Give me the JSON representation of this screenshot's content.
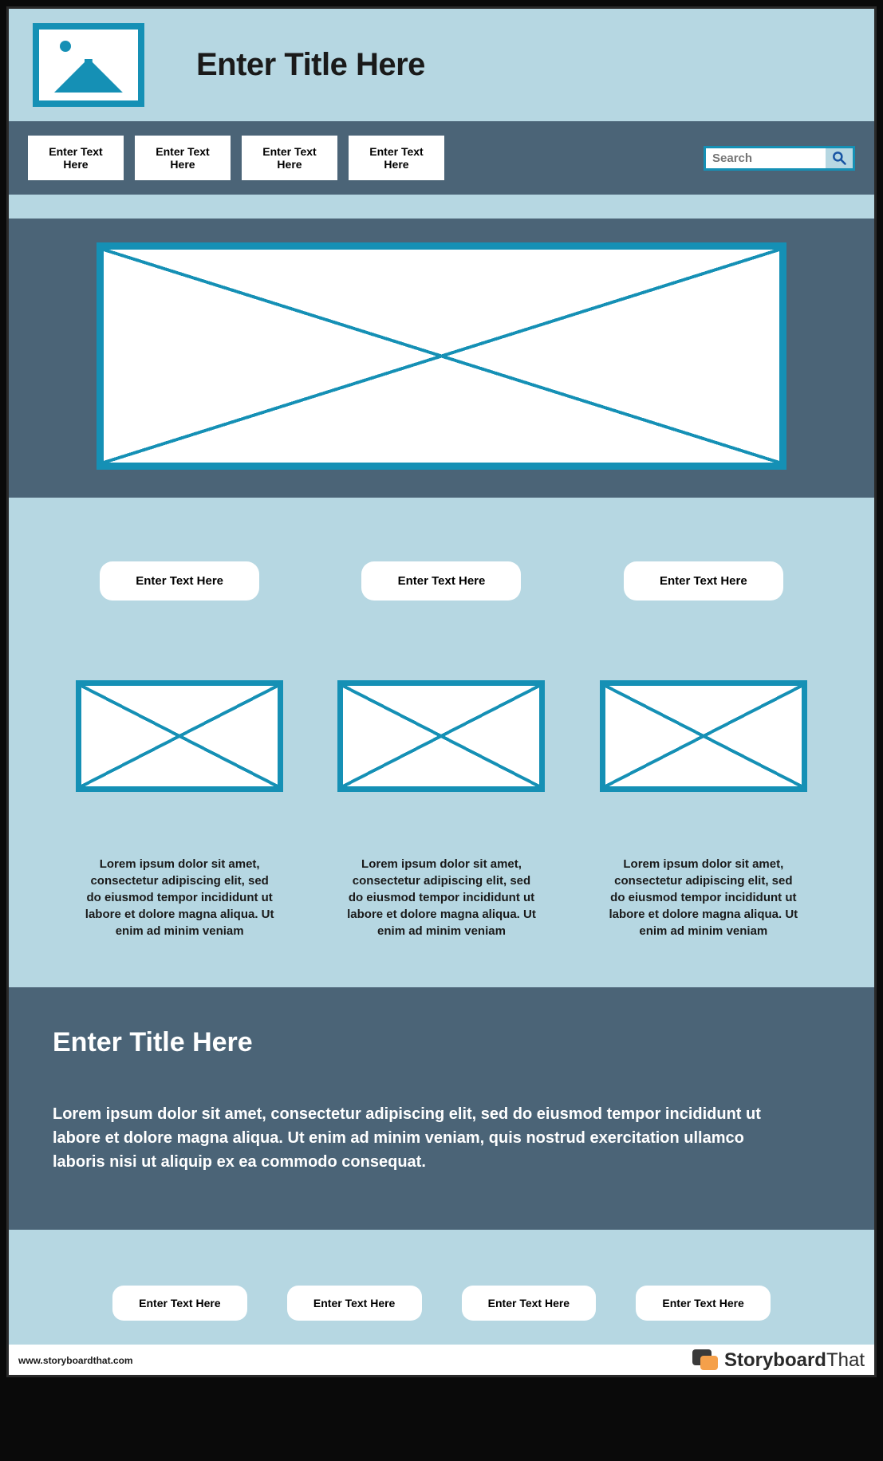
{
  "header": {
    "title": "Enter Title Here"
  },
  "nav": {
    "items": [
      {
        "label": "Enter Text Here"
      },
      {
        "label": "Enter Text Here"
      },
      {
        "label": "Enter Text Here"
      },
      {
        "label": "Enter Text Here"
      }
    ],
    "search_placeholder": "Search"
  },
  "three_up": {
    "buttons": [
      {
        "label": "Enter Text Here"
      },
      {
        "label": "Enter Text Here"
      },
      {
        "label": "Enter Text Here"
      }
    ],
    "cards": [
      {
        "text": "Lorem ipsum dolor sit amet, consectetur adipiscing elit, sed do eiusmod tempor incididunt ut labore et dolore magna aliqua. Ut enim ad minim veniam"
      },
      {
        "text": "Lorem ipsum dolor sit amet, consectetur adipiscing elit, sed do eiusmod tempor incididunt ut labore et dolore magna aliqua. Ut enim ad minim veniam"
      },
      {
        "text": "Lorem ipsum dolor sit amet, consectetur adipiscing elit, sed do eiusmod tempor incididunt ut labore et dolore magna aliqua. Ut enim ad minim veniam"
      }
    ]
  },
  "info": {
    "title": "Enter Title Here",
    "body": "Lorem ipsum dolor sit amet, consectetur adipiscing elit, sed do eiusmod tempor incididunt ut labore et dolore magna aliqua. Ut enim ad minim veniam, quis nostrud exercitation ullamco laboris nisi ut aliquip ex ea commodo consequat."
  },
  "footer": {
    "buttons": [
      {
        "label": "Enter Text Here"
      },
      {
        "label": "Enter Text Here"
      },
      {
        "label": "Enter Text Here"
      },
      {
        "label": "Enter Text Here"
      }
    ]
  },
  "bottom": {
    "url": "www.storyboardthat.com",
    "brand_bold": "Storyboard",
    "brand_light": "That"
  },
  "colors": {
    "light": "#b6d7e2",
    "dark": "#4b6477",
    "accent": "#1590b5"
  }
}
